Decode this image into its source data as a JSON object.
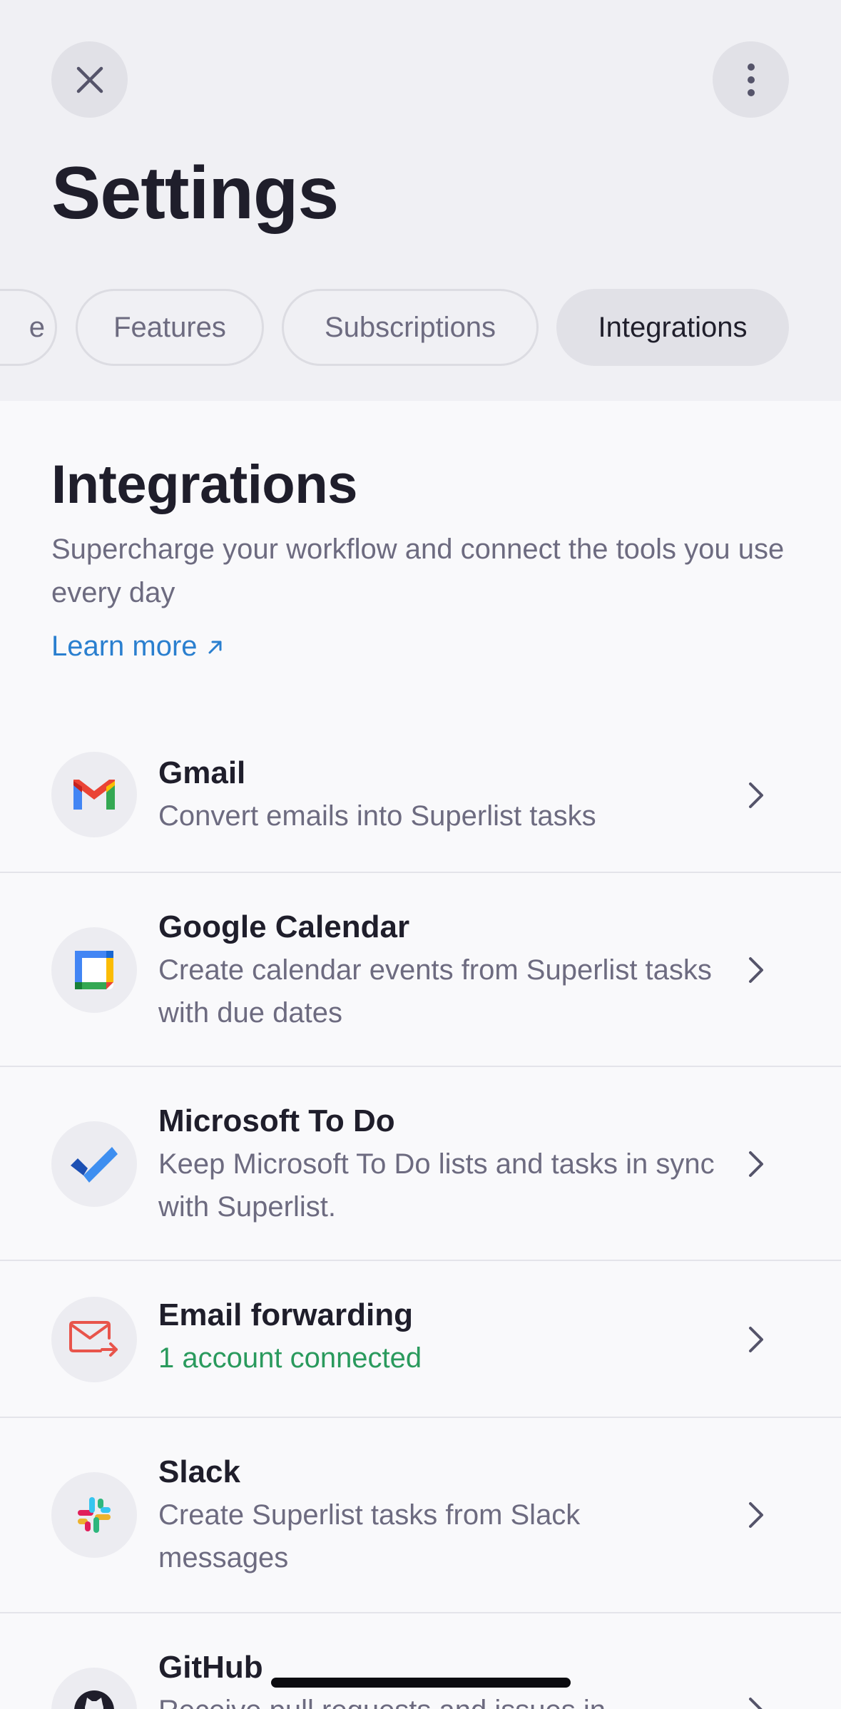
{
  "header": {
    "title": "Settings",
    "close_icon": "close-icon",
    "more_icon": "more-vertical-icon"
  },
  "tabs": [
    {
      "label": "e",
      "active": false
    },
    {
      "label": "Features",
      "active": false
    },
    {
      "label": "Subscriptions",
      "active": false
    },
    {
      "label": "Integrations",
      "active": true
    }
  ],
  "section": {
    "title": "Integrations",
    "description": "Supercharge your workflow and connect the tools you use every day",
    "learn_more": "Learn more",
    "learn_more_icon": "arrow-up-right-icon"
  },
  "integrations": [
    {
      "name": "Gmail",
      "description": "Convert emails into Superlist tasks",
      "icon": "gmail-icon"
    },
    {
      "name": "Google Calendar",
      "description": "Create calendar events from Superlist tasks with due dates",
      "icon": "google-calendar-icon"
    },
    {
      "name": "Microsoft To Do",
      "description": "Keep Microsoft To Do lists and tasks in sync with Superlist.",
      "icon": "microsoft-todo-icon"
    },
    {
      "name": "Email forwarding",
      "description": "1 account connected",
      "icon": "email-forward-icon",
      "status_color": "#2a9a5d"
    },
    {
      "name": "Slack",
      "description": "Create Superlist tasks from Slack messages",
      "icon": "slack-icon"
    },
    {
      "name": "GitHub",
      "description": "Receive pull requests and issues in",
      "icon": "github-icon"
    }
  ],
  "colors": {
    "accent_link": "#2a7fcf",
    "status_green": "#2a9a5d",
    "header_bg": "#f0f0f4",
    "content_bg": "#f9f9fb"
  }
}
